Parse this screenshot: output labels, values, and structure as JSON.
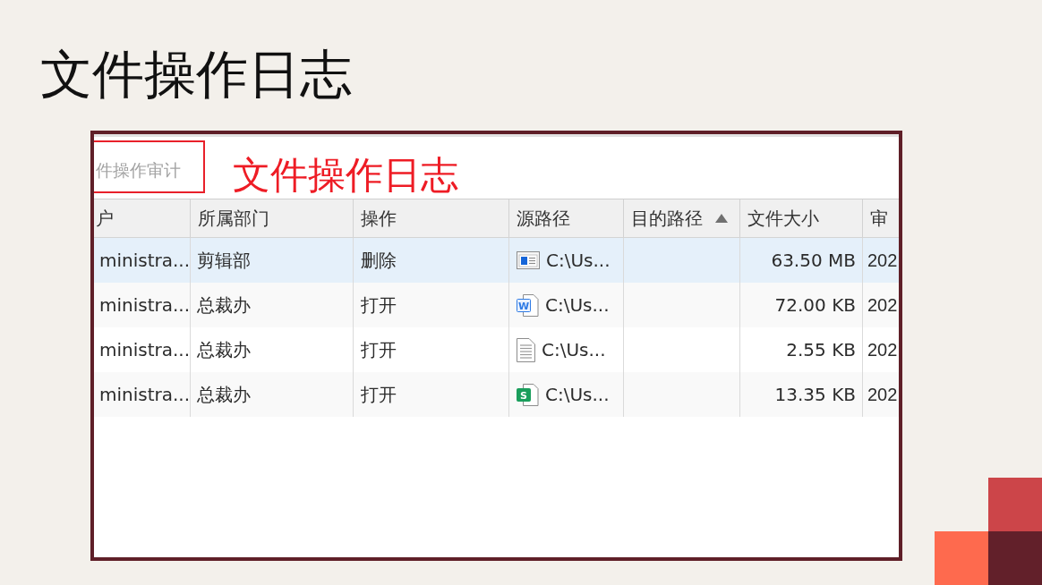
{
  "slide": {
    "title": "文件操作日志",
    "screenshot": {
      "search": {
        "placeholder": "件操作审计",
        "highlighted": true
      },
      "annotation": "文件操作日志",
      "table": {
        "columns": [
          {
            "label": "户",
            "sorted": false
          },
          {
            "label": "所属部门",
            "sorted": false
          },
          {
            "label": "操作",
            "sorted": false
          },
          {
            "label": "源路径",
            "sorted": false
          },
          {
            "label": "目的路径",
            "sorted": true
          },
          {
            "label": "文件大小",
            "sorted": false
          },
          {
            "label": "审",
            "sorted": false
          }
        ],
        "rows": [
          {
            "selected": true,
            "user": "ministra...",
            "department": "剪辑部",
            "operation": "删除",
            "kind": "app",
            "source_path": "C:\\Us...",
            "size": "63.50 MB",
            "column_7": "202"
          },
          {
            "selected": false,
            "user": "ministra...",
            "department": "总裁办",
            "operation": "打开",
            "kind": "word",
            "badge": "W",
            "source_path": "C:\\Us...",
            "size": "72.00 KB",
            "column_7": "202"
          },
          {
            "selected": false,
            "user": "ministra...",
            "department": "总裁办",
            "operation": "打开",
            "kind": "text",
            "source_path": "C:\\Us...",
            "size": "2.55 KB",
            "column_7": "202"
          },
          {
            "selected": false,
            "user": "ministra...",
            "department": "总裁办",
            "operation": "打开",
            "kind": "sheet",
            "badge": "S",
            "source_path": "C:\\Us...",
            "size": "13.35 KB",
            "column_7": "202"
          }
        ]
      }
    }
  }
}
